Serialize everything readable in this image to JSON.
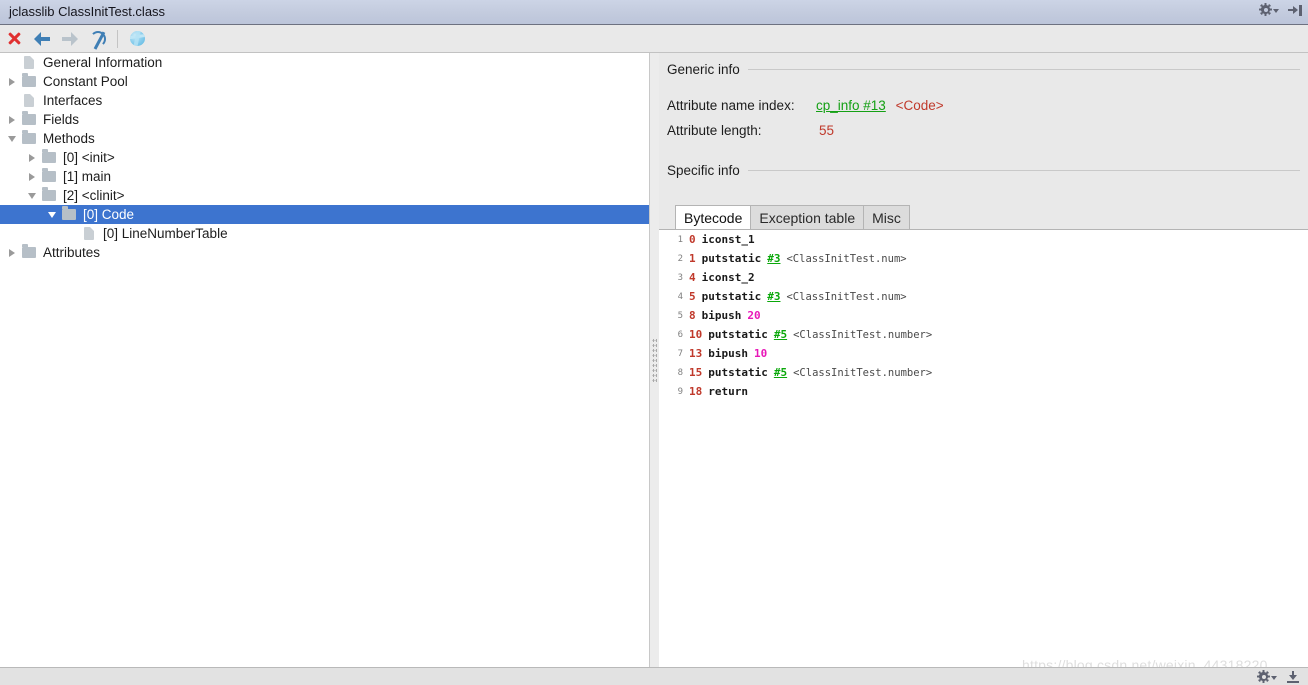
{
  "window": {
    "title": "jclasslib ClassInitTest.class",
    "titlebar_icons": [
      "gear-icon",
      "hide-sidebar-icon"
    ]
  },
  "toolbar": {
    "buttons": [
      {
        "name": "close-icon",
        "tooltip": "Close"
      },
      {
        "name": "back-icon",
        "tooltip": "Backward"
      },
      {
        "name": "forward-icon",
        "tooltip": "Forward"
      },
      {
        "name": "reload-icon",
        "tooltip": "Reload"
      },
      {
        "name": "browse-icon",
        "tooltip": "Show in browser"
      }
    ]
  },
  "tree": {
    "items": [
      {
        "label": "General Information",
        "indent": 1,
        "icon": "page-icon",
        "toggle": "none",
        "selected": false
      },
      {
        "label": "Constant Pool",
        "indent": 1,
        "icon": "folder-icon",
        "toggle": "collapsed",
        "selected": false
      },
      {
        "label": "Interfaces",
        "indent": 1,
        "icon": "page-icon",
        "toggle": "none",
        "selected": false
      },
      {
        "label": "Fields",
        "indent": 1,
        "icon": "folder-icon",
        "toggle": "collapsed",
        "selected": false
      },
      {
        "label": "Methods",
        "indent": 1,
        "icon": "folder-icon",
        "toggle": "expanded",
        "selected": false
      },
      {
        "label": "[0] <init>",
        "indent": 2,
        "icon": "folder-icon",
        "toggle": "collapsed",
        "selected": false
      },
      {
        "label": "[1] main",
        "indent": 2,
        "icon": "folder-icon",
        "toggle": "collapsed",
        "selected": false
      },
      {
        "label": "[2] <clinit>",
        "indent": 2,
        "icon": "folder-icon",
        "toggle": "expanded",
        "selected": false
      },
      {
        "label": "[0] Code",
        "indent": 3,
        "icon": "folder-icon",
        "toggle": "expanded",
        "selected": true
      },
      {
        "label": "[0] LineNumberTable",
        "indent": 4,
        "icon": "page-icon",
        "toggle": "none",
        "selected": false
      },
      {
        "label": "Attributes",
        "indent": 1,
        "icon": "folder-icon",
        "toggle": "collapsed",
        "selected": false
      }
    ]
  },
  "detail": {
    "generic_info_heading": "Generic info",
    "specific_info_heading": "Specific info",
    "fields": [
      {
        "label": "Attribute name index:",
        "link": "cp_info #13",
        "suffix": "<Code>"
      },
      {
        "label": "Attribute length:",
        "value": "55"
      }
    ],
    "tabs": [
      {
        "label": "Bytecode",
        "active": true
      },
      {
        "label": "Exception table",
        "active": false
      },
      {
        "label": "Misc",
        "active": false
      }
    ],
    "bytecode": [
      {
        "line": "1",
        "offset": "0",
        "mnemonic": "iconst_1",
        "ref": "",
        "comment": "",
        "literal": ""
      },
      {
        "line": "2",
        "offset": "1",
        "mnemonic": "putstatic",
        "ref": "#3",
        "comment": "<ClassInitTest.num>",
        "literal": ""
      },
      {
        "line": "3",
        "offset": "4",
        "mnemonic": "iconst_2",
        "ref": "",
        "comment": "",
        "literal": ""
      },
      {
        "line": "4",
        "offset": "5",
        "mnemonic": "putstatic",
        "ref": "#3",
        "comment": "<ClassInitTest.num>",
        "literal": ""
      },
      {
        "line": "5",
        "offset": "8",
        "mnemonic": "bipush",
        "ref": "",
        "comment": "",
        "literal": "20"
      },
      {
        "line": "6",
        "offset": "10",
        "mnemonic": "putstatic",
        "ref": "#5",
        "comment": "<ClassInitTest.number>",
        "literal": ""
      },
      {
        "line": "7",
        "offset": "13",
        "mnemonic": "bipush",
        "ref": "",
        "comment": "",
        "literal": "10"
      },
      {
        "line": "8",
        "offset": "15",
        "mnemonic": "putstatic",
        "ref": "#5",
        "comment": "<ClassInitTest.number>",
        "literal": ""
      },
      {
        "line": "9",
        "offset": "18",
        "mnemonic": "return",
        "ref": "",
        "comment": "",
        "literal": ""
      }
    ]
  },
  "statusbar": {
    "icons": [
      "gear-icon",
      "download-icon"
    ]
  },
  "watermark": "https://blog.csdn.net/weixin_44318220",
  "colors": {
    "titlebar": "#c3cbde",
    "toolbar": "#e9e9e9",
    "selection_blue": "#3d74cf",
    "link_green": "#14a014",
    "value_red": "#c0392b",
    "literal_magenta": "#e818b8",
    "panel_gray": "#e9e9e9"
  }
}
